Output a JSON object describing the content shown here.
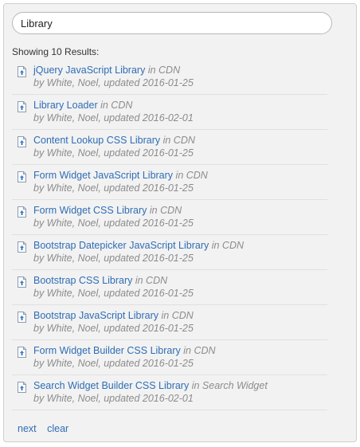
{
  "search": {
    "value": "Library"
  },
  "results_count_text": "Showing 10 Results:",
  "results": [
    {
      "title": "jQuery JavaScript Library",
      "in": "in CDN",
      "meta": "by White, Noel, updated 2016-01-25"
    },
    {
      "title": "Library Loader",
      "in": "in CDN",
      "meta": "by White, Noel, updated 2016-02-01"
    },
    {
      "title": "Content Lookup CSS Library",
      "in": "in CDN",
      "meta": "by White, Noel, updated 2016-01-25"
    },
    {
      "title": "Form Widget JavaScript Library",
      "in": "in CDN",
      "meta": "by White, Noel, updated 2016-01-25"
    },
    {
      "title": "Form Widget CSS Library",
      "in": "in CDN",
      "meta": "by White, Noel, updated 2016-01-25"
    },
    {
      "title": "Bootstrap Datepicker JavaScript Library",
      "in": "in CDN",
      "meta": "by White, Noel, updated 2016-01-25"
    },
    {
      "title": "Bootstrap CSS Library",
      "in": "in CDN",
      "meta": "by White, Noel, updated 2016-01-25"
    },
    {
      "title": "Bootstrap JavaScript Library",
      "in": "in CDN",
      "meta": "by White, Noel, updated 2016-01-25"
    },
    {
      "title": "Form Widget Builder CSS Library",
      "in": "in CDN",
      "meta": "by White, Noel, updated 2016-01-25"
    },
    {
      "title": "Search Widget Builder CSS Library",
      "in": "in Search Widget",
      "meta": "by White, Noel, updated 2016-02-01"
    }
  ],
  "result_icon": "document-upload-icon",
  "footer": {
    "next_label": "next",
    "clear_label": "clear"
  },
  "colors": {
    "link": "#2f6db5",
    "muted": "#8c8c8c",
    "panel": "#f2f2f2"
  }
}
